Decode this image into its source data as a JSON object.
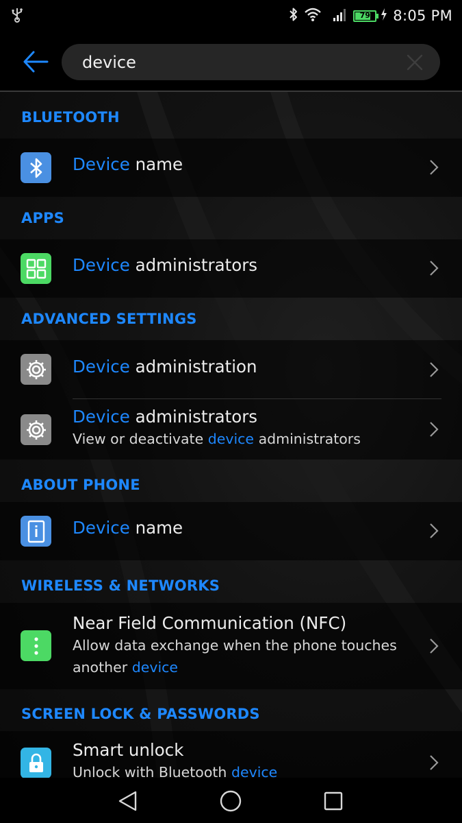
{
  "status_bar": {
    "time": "8:05 PM",
    "battery_level": "79",
    "battery_fraction": 0.79,
    "icons": [
      "usb-icon",
      "bluetooth-icon",
      "wifi-icon",
      "signal-icon",
      "battery-icon",
      "charging-icon"
    ]
  },
  "search": {
    "query": "device",
    "back_icon": "arrow-left-icon",
    "clear_icon": "close-icon"
  },
  "colors": {
    "accent": "#1e88ff",
    "bluetooth_icon_bg": "#4a90e2",
    "apps_icon_bg": "#4cd964",
    "settings_icon_bg": "#9e9e9e",
    "about_icon_bg": "#4a90e2",
    "nfc_icon_bg": "#4cd964",
    "lock_icon_bg": "#33b5e5"
  },
  "sections": [
    {
      "header": "BLUETOOTH",
      "items": [
        {
          "icon": "bluetooth-icon",
          "title_hl": "Device",
          "title_rest": " name"
        }
      ]
    },
    {
      "header": "APPS",
      "items": [
        {
          "icon": "apps-grid-icon",
          "title_hl": "Device",
          "title_rest": " administrators"
        }
      ]
    },
    {
      "header": "ADVANCED SETTINGS",
      "items": [
        {
          "icon": "gear-icon",
          "title_hl": "Device",
          "title_rest": " administration"
        },
        {
          "icon": "gear-icon",
          "title_hl": "Device",
          "title_rest": " administrators",
          "sub_pre": "View or deactivate ",
          "sub_hl": "device",
          "sub_post": " administrators"
        }
      ]
    },
    {
      "header": "ABOUT PHONE",
      "items": [
        {
          "icon": "info-icon",
          "title_hl": "Device",
          "title_rest": " name"
        }
      ]
    },
    {
      "header": "WIRELESS & NETWORKS",
      "items": [
        {
          "icon": "more-vertical-icon",
          "title": "Near Field Communication (NFC)",
          "sub_pre": "Allow data exchange when the phone touches another ",
          "sub_hl": "device"
        }
      ]
    },
    {
      "header": "SCREEN LOCK & PASSWORDS",
      "items": [
        {
          "icon": "lock-icon",
          "title": "Smart unlock",
          "sub_pre": "Unlock with Bluetooth ",
          "sub_hl": "device"
        }
      ]
    }
  ],
  "nav_bar": {
    "icons": [
      "back-triangle-icon",
      "home-circle-icon",
      "recents-square-icon"
    ]
  }
}
